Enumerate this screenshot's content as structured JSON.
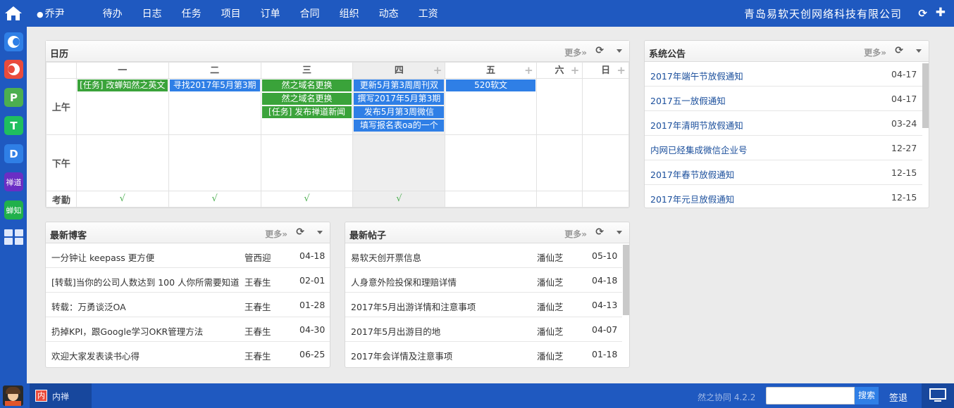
{
  "topbar": {
    "user": "乔尹",
    "nav": [
      "待办",
      "日志",
      "任务",
      "项目",
      "订单",
      "合同",
      "组织",
      "动态",
      "工资"
    ],
    "company": "青岛易软天创网络科技有限公司"
  },
  "sidebar": {
    "apps": [
      {
        "icon": "c-app-icon",
        "color": "#2f7fe6"
      },
      {
        "icon": "o-app-icon",
        "color": "#e94b3c"
      },
      {
        "icon": "p-app-icon",
        "color": "#4caf50",
        "letter": "P"
      },
      {
        "icon": "t-app-icon",
        "color": "#1fbf5f",
        "letter": "T"
      },
      {
        "icon": "d-app-icon",
        "color": "#2f7fe6",
        "letter": "D"
      },
      {
        "icon": "chandao-app-icon",
        "color": "#6a2ec4",
        "label": "禅道"
      },
      {
        "icon": "chanzhi-app-icon",
        "color": "#20b04b",
        "label": "蝉知"
      }
    ]
  },
  "calendar": {
    "title": "日历",
    "more": "更多»",
    "days": [
      "一",
      "二",
      "三",
      "四",
      "五",
      "六",
      "日"
    ],
    "rows": [
      "上午",
      "下午",
      "考勤"
    ],
    "morning": [
      [
        {
          "t": "[任务] 改蝉知然之英文",
          "c": "g"
        }
      ],
      [
        {
          "t": "寻找2017年5月第3期",
          "c": "b"
        }
      ],
      [
        {
          "t": "然之域名更换",
          "c": "g"
        },
        {
          "t": "然之域名更换",
          "c": "g"
        },
        {
          "t": "[任务] 发布禅道新闻",
          "c": "g"
        }
      ],
      [
        {
          "t": "更新5月第3周周刊双",
          "c": "b"
        },
        {
          "t": "撰写2017年5月第3期",
          "c": "b"
        },
        {
          "t": "发布5月第3周微信",
          "c": "b"
        },
        {
          "t": "填写报名表oa的一个",
          "c": "b"
        }
      ],
      [
        {
          "t": "520软文",
          "c": "b"
        }
      ],
      [],
      []
    ],
    "attendance": [
      "√",
      "√",
      "√",
      "√",
      "",
      "",
      ""
    ]
  },
  "notices": {
    "title": "系统公告",
    "more": "更多»",
    "items": [
      {
        "title": "2017年端午节放假通知",
        "date": "04-17"
      },
      {
        "title": "2017五一放假通知",
        "date": "04-17"
      },
      {
        "title": "2017年清明节放假通知",
        "date": "03-24"
      },
      {
        "title": "内网已经集成微信企业号",
        "date": "12-27"
      },
      {
        "title": "2017年春节放假通知",
        "date": "12-15"
      },
      {
        "title": "2017年元旦放假通知",
        "date": "12-15"
      }
    ]
  },
  "blogs": {
    "title": "最新博客",
    "more": "更多»",
    "items": [
      {
        "title": "一分钟让 keepass 更方便",
        "author": "管西迎",
        "date": "04-18"
      },
      {
        "title": "[转载]当你的公司人数达到 100 人你所需要知道",
        "author": "王春生",
        "date": "02-01"
      },
      {
        "title": "转载：万勇谈泛OA",
        "author": "王春生",
        "date": "01-28"
      },
      {
        "title": "扔掉KPI，跟Google学习OKR管理方法",
        "author": "王春生",
        "date": "04-30"
      },
      {
        "title": "欢迎大家发表读书心得",
        "author": "王春生",
        "date": "06-25"
      }
    ]
  },
  "posts": {
    "title": "最新帖子",
    "more": "更多»",
    "items": [
      {
        "title": "易软天创开票信息",
        "author": "潘仙芝",
        "date": "05-10"
      },
      {
        "title": "人身意外险投保和理赔详情",
        "author": "潘仙芝",
        "date": "04-18"
      },
      {
        "title": "2017年5月出游详情和注意事项",
        "author": "潘仙芝",
        "date": "04-13"
      },
      {
        "title": "2017年5月出游目的地",
        "author": "潘仙芝",
        "date": "04-07"
      },
      {
        "title": "2017年会详情及注意事项",
        "author": "潘仙芝",
        "date": "01-18"
      }
    ]
  },
  "bottombar": {
    "task_label": "内禅",
    "task_badge": "内",
    "version": "然之协同 4.2.2",
    "search_button": "搜索",
    "logout": "签退"
  }
}
